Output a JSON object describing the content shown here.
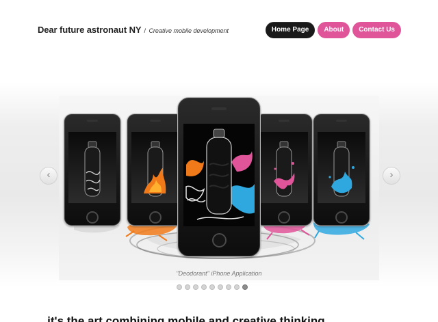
{
  "header": {
    "title": "Dear future astronaut NY",
    "separator": "/",
    "tagline": "Creative mobile development"
  },
  "nav": {
    "home": "Home Page",
    "about": "About",
    "contact": "Contact Us"
  },
  "slider": {
    "caption": "\"Deodorant\" iPhone Application",
    "slides_total": 9,
    "active_slide_index": 8
  },
  "colors": {
    "accent_pink": "#e0559a",
    "nav_active": "#1a1a1a",
    "splash_orange": "#f07a1a",
    "splash_pink": "#e0559a",
    "splash_blue": "#2fa8e0"
  },
  "main": {
    "intro_text": "...it's the art combining mobile and creative thinking..."
  }
}
